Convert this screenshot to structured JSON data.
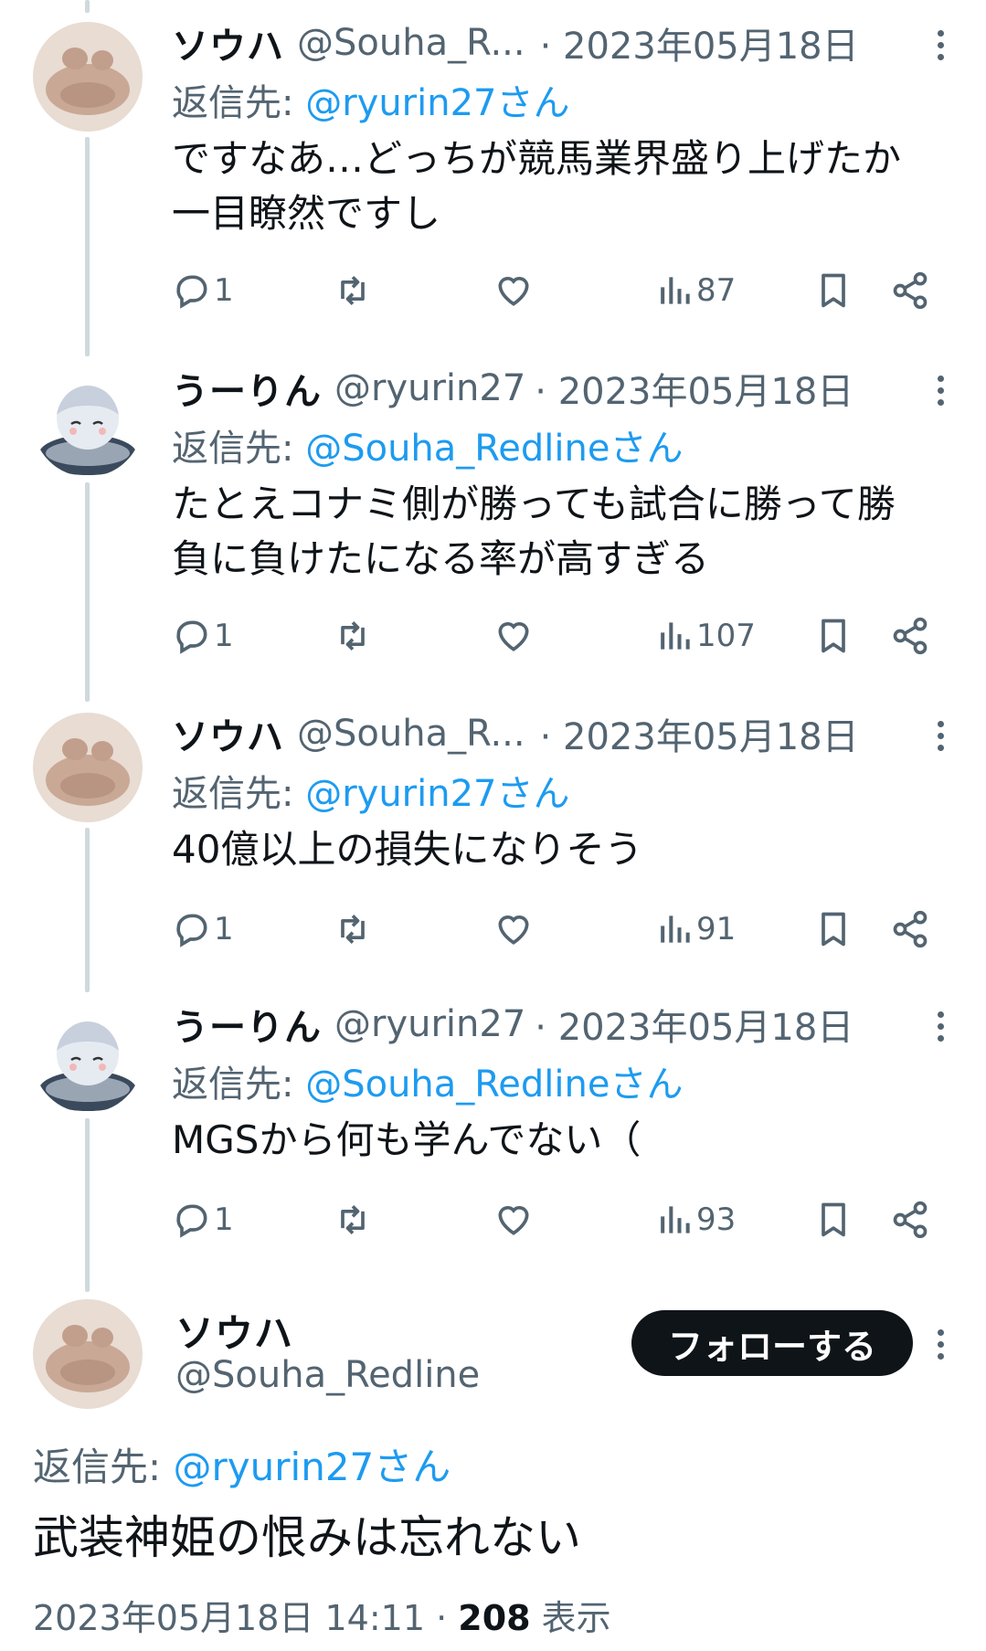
{
  "thread": [
    {
      "name": "ソウハ",
      "handle": "@Souha_R...",
      "date": "· 2023年05月18日",
      "reply_prefix": "返信先: ",
      "reply_mention": "@ryurin27さん",
      "text_lines": [
        "ですなあ…どっちが競馬業界盛り上げたか",
        "一目瞭然ですし"
      ],
      "stats": {
        "replies": "1",
        "views": "87"
      },
      "avatar": "clay-creature-avatar"
    },
    {
      "name": "うーりん",
      "handle": "@ryurin27",
      "date": "· 2023年05月18日",
      "reply_prefix": "返信先: ",
      "reply_mention": "@Souha_Redlineさん",
      "text_lines": [
        "たとえコナミ側が勝っても試合に勝って勝",
        "負に負けたになる率が高すぎる"
      ],
      "stats": {
        "replies": "1",
        "views": "107"
      },
      "avatar": "anime-character-avatar"
    },
    {
      "name": "ソウハ",
      "handle": "@Souha_R...",
      "date": "· 2023年05月18日",
      "reply_prefix": "返信先: ",
      "reply_mention": "@ryurin27さん",
      "text_lines": [
        "40億以上の損失になりそう"
      ],
      "stats": {
        "replies": "1",
        "views": "91"
      },
      "avatar": "clay-creature-avatar"
    },
    {
      "name": "うーりん",
      "handle": "@ryurin27",
      "date": "· 2023年05月18日",
      "reply_prefix": "返信先: ",
      "reply_mention": "@Souha_Redlineさん",
      "text_lines": [
        "MGSから何も学んでない（"
      ],
      "stats": {
        "replies": "1",
        "views": "93"
      },
      "avatar": "anime-character-avatar"
    }
  ],
  "main_tweet": {
    "name": "ソウハ",
    "handle": "@Souha_Redline",
    "follow_label": "フォローする",
    "reply_prefix": "返信先: ",
    "reply_mention": "@ryurin27さん",
    "text": "武装神姫の恨みは忘れない",
    "timestamp": "2023年05月18日 14:11 · ",
    "views_count": "208",
    "views_label": " 表示"
  },
  "colors": {
    "accent": "#1d9bf0",
    "secondary_text": "#536471",
    "thread_line": "#cfd9de"
  },
  "icons": [
    "reply-icon",
    "retweet-icon",
    "like-icon",
    "views-icon",
    "bookmark-icon",
    "share-icon",
    "more-icon"
  ]
}
